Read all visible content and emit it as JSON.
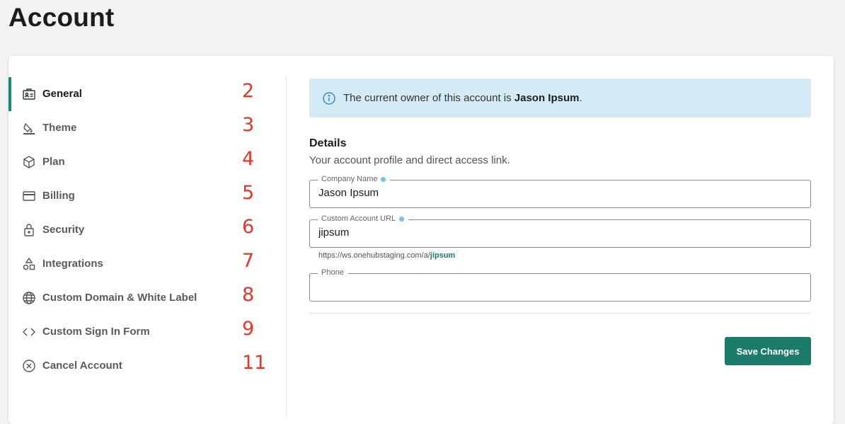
{
  "page": {
    "title": "Account"
  },
  "sidebar": {
    "items": [
      {
        "label": "General",
        "icon": "id-card-icon",
        "num": "2",
        "active": true
      },
      {
        "label": "Theme",
        "icon": "paint-bucket-icon",
        "num": "3"
      },
      {
        "label": "Plan",
        "icon": "package-icon",
        "num": "4"
      },
      {
        "label": "Billing",
        "icon": "credit-card-icon",
        "num": "5"
      },
      {
        "label": "Security",
        "icon": "lock-icon",
        "num": "6"
      },
      {
        "label": "Integrations",
        "icon": "shapes-icon",
        "num": "7"
      },
      {
        "label": "Custom Domain & White Label",
        "icon": "globe-icon",
        "num": "8"
      },
      {
        "label": "Custom Sign In Form",
        "icon": "code-icon",
        "num": "9"
      },
      {
        "label": "Cancel Account",
        "icon": "x-circle-icon",
        "num": "11"
      }
    ]
  },
  "banner": {
    "prefix": "The current owner of this account is ",
    "owner": "Jason Ipsum",
    "suffix": ".",
    "icon": "info-icon"
  },
  "details": {
    "title": "Details",
    "subtitle": "Your account profile and direct access link."
  },
  "fields": {
    "company_name": {
      "label": "Company Name",
      "value": "Jason Ipsum"
    },
    "custom_url": {
      "label": "Custom Account URL",
      "value": "jipsum"
    },
    "phone": {
      "label": "Phone",
      "value": ""
    }
  },
  "url_hint": {
    "base": "https://ws.onehubstaging.com/a/",
    "slug": "jipsum"
  },
  "actions": {
    "save_label": "Save Changes"
  },
  "colors": {
    "accent": "#1b7c6c",
    "banner_bg": "#d4ebf6",
    "annotation": "#e8352c"
  }
}
